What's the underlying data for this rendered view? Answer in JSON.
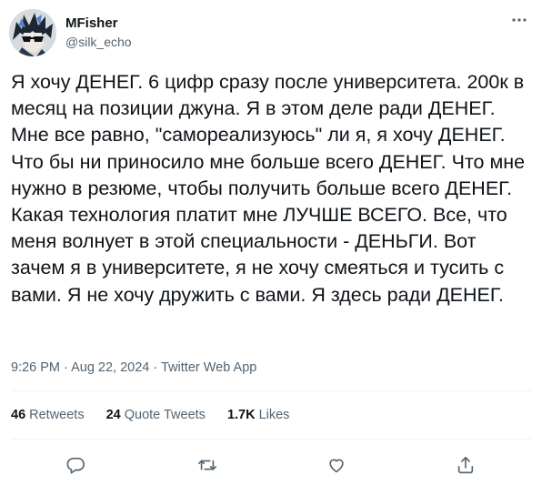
{
  "user": {
    "display_name": "MFisher",
    "handle": "@silk_echo",
    "avatar_icon": "anime-avatar"
  },
  "tweet": {
    "text": "Я хочу ДЕНЕГ. 6 цифр сразу после университета. 200к в месяц на позиции джуна. Я в этом деле ради ДЕНЕГ. Мне все равно, \"самореализуюсь\" ли я, я хочу ДЕНЕГ. Что бы ни приносило мне больше всего ДЕНЕГ. Что мне нужно в резюме, чтобы получить больше всего ДЕНЕГ. Какая технология платит мне ЛУЧШЕ ВСЕГО. Все, что меня волнует в этой специальности - ДЕНЬГИ. Вот зачем я в университете, я не хочу смеяться и тусить с вами. Я не хочу дружить с вами. Я здесь ради ДЕНЕГ.",
    "time": "9:26 PM",
    "date": "Aug 22, 2024",
    "source": "Twitter Web App",
    "separator": "·"
  },
  "stats": {
    "retweets_count": "46",
    "retweets_label": "Retweets",
    "quote_count": "24",
    "quote_label": "Quote Tweets",
    "likes_count": "1.7K",
    "likes_label": "Likes"
  },
  "actions": [
    "reply-icon",
    "retweet-icon",
    "like-icon",
    "share-icon"
  ],
  "colors": {
    "text_primary": "#0f1419",
    "text_secondary": "#536471",
    "divider": "#eff3f4",
    "brand_blue": "#1d9bf0"
  }
}
